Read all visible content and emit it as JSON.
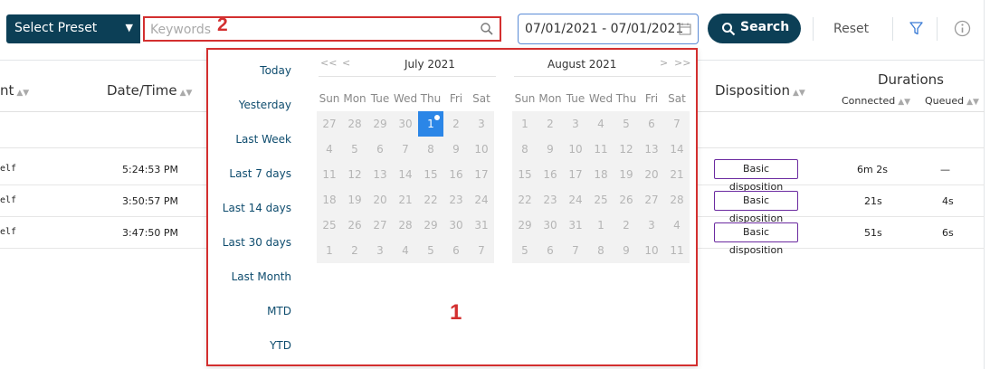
{
  "toolbar": {
    "preset_label": "Select Preset",
    "keyword_placeholder": "Keywords",
    "keyword_marker": "2",
    "date_range": "07/01/2021 - 07/01/2021",
    "search_label": "Search",
    "reset_label": "Reset"
  },
  "table": {
    "headers": {
      "col1": "nt",
      "datetime": "Date/Time",
      "disposition": "Disposition",
      "durations": "Durations",
      "connected": "Connected",
      "queued": "Queued"
    },
    "rows": [
      {
        "col1": "elf",
        "time": "5:24:53 PM",
        "disposition": "Basic disposition",
        "connected": "6m 2s",
        "queued": "—"
      },
      {
        "col1": "elf",
        "time": "3:50:57 PM",
        "disposition": "Basic disposition",
        "connected": "21s",
        "queued": "4s"
      },
      {
        "col1": "elf",
        "time": "3:47:50 PM",
        "disposition": "Basic disposition",
        "connected": "51s",
        "queued": "6s"
      }
    ]
  },
  "datepicker": {
    "presets": [
      "Today",
      "Yesterday",
      "Last Week",
      "Last 7 days",
      "Last 14 days",
      "Last 30 days",
      "Last Month",
      "MTD",
      "YTD"
    ],
    "nav": {
      "prev_year": "<<",
      "prev_month": "<",
      "next_month": ">",
      "next_year": ">>"
    },
    "weekdays": [
      "Sun",
      "Mon",
      "Tue",
      "Wed",
      "Thu",
      "Fri",
      "Sat"
    ],
    "marker": "1",
    "months": [
      {
        "title": "July 2021",
        "days": [
          [
            "27",
            "28",
            "29",
            "30",
            "1",
            "2",
            "3"
          ],
          [
            "4",
            "5",
            "6",
            "7",
            "8",
            "9",
            "10"
          ],
          [
            "11",
            "12",
            "13",
            "14",
            "15",
            "16",
            "17"
          ],
          [
            "18",
            "19",
            "20",
            "21",
            "22",
            "23",
            "24"
          ],
          [
            "25",
            "26",
            "27",
            "28",
            "29",
            "30",
            "31"
          ],
          [
            "1",
            "2",
            "3",
            "4",
            "5",
            "6",
            "7"
          ]
        ],
        "selected_day": "1"
      },
      {
        "title": "August 2021",
        "days": [
          [
            "1",
            "2",
            "3",
            "4",
            "5",
            "6",
            "7"
          ],
          [
            "8",
            "9",
            "10",
            "11",
            "12",
            "13",
            "14"
          ],
          [
            "15",
            "16",
            "17",
            "18",
            "19",
            "20",
            "21"
          ],
          [
            "22",
            "23",
            "24",
            "25",
            "26",
            "27",
            "28"
          ],
          [
            "29",
            "30",
            "31",
            "1",
            "2",
            "3",
            "4"
          ],
          [
            "5",
            "6",
            "7",
            "8",
            "9",
            "10",
            "11"
          ]
        ]
      }
    ]
  },
  "colors": {
    "brand": "#0c3f56",
    "highlight": "#d32f2f",
    "selected": "#2b86e7",
    "badge_border": "#6b2aa0"
  }
}
